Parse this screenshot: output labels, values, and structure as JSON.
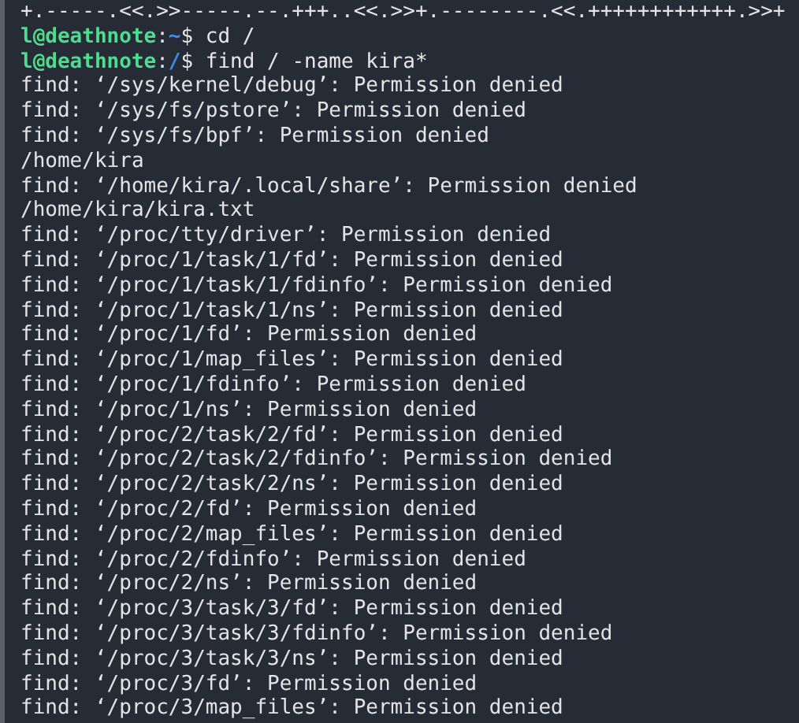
{
  "lines": [
    {
      "kind": "output",
      "text": "+.-----.<<.>>-----.--.+++..<<.>>+.--------.<<.++++++++++++.>>+"
    },
    {
      "kind": "prompt",
      "user_host": "l@deathnote",
      "colon": ":",
      "path": "~",
      "command": "$ cd /"
    },
    {
      "kind": "prompt",
      "user_host": "l@deathnote",
      "colon": ":",
      "path": "/",
      "command": "$ find / -name kira*"
    },
    {
      "kind": "output",
      "text": "find: ‘/sys/kernel/debug’: Permission denied"
    },
    {
      "kind": "output",
      "text": "find: ‘/sys/fs/pstore’: Permission denied"
    },
    {
      "kind": "output",
      "text": "find: ‘/sys/fs/bpf’: Permission denied"
    },
    {
      "kind": "output",
      "text": "/home/kira"
    },
    {
      "kind": "output",
      "text": "find: ‘/home/kira/.local/share’: Permission denied"
    },
    {
      "kind": "output",
      "text": "/home/kira/kira.txt"
    },
    {
      "kind": "output",
      "text": "find: ‘/proc/tty/driver’: Permission denied"
    },
    {
      "kind": "output",
      "text": "find: ‘/proc/1/task/1/fd’: Permission denied"
    },
    {
      "kind": "output",
      "text": "find: ‘/proc/1/task/1/fdinfo’: Permission denied"
    },
    {
      "kind": "output",
      "text": "find: ‘/proc/1/task/1/ns’: Permission denied"
    },
    {
      "kind": "output",
      "text": "find: ‘/proc/1/fd’: Permission denied"
    },
    {
      "kind": "output",
      "text": "find: ‘/proc/1/map_files’: Permission denied"
    },
    {
      "kind": "output",
      "text": "find: ‘/proc/1/fdinfo’: Permission denied"
    },
    {
      "kind": "output",
      "text": "find: ‘/proc/1/ns’: Permission denied"
    },
    {
      "kind": "output",
      "text": "find: ‘/proc/2/task/2/fd’: Permission denied"
    },
    {
      "kind": "output",
      "text": "find: ‘/proc/2/task/2/fdinfo’: Permission denied"
    },
    {
      "kind": "output",
      "text": "find: ‘/proc/2/task/2/ns’: Permission denied"
    },
    {
      "kind": "output",
      "text": "find: ‘/proc/2/fd’: Permission denied"
    },
    {
      "kind": "output",
      "text": "find: ‘/proc/2/map_files’: Permission denied"
    },
    {
      "kind": "output",
      "text": "find: ‘/proc/2/fdinfo’: Permission denied"
    },
    {
      "kind": "output",
      "text": "find: ‘/proc/2/ns’: Permission denied"
    },
    {
      "kind": "output",
      "text": "find: ‘/proc/3/task/3/fd’: Permission denied"
    },
    {
      "kind": "output",
      "text": "find: ‘/proc/3/task/3/fdinfo’: Permission denied"
    },
    {
      "kind": "output",
      "text": "find: ‘/proc/3/task/3/ns’: Permission denied"
    },
    {
      "kind": "output",
      "text": "find: ‘/proc/3/fd’: Permission denied"
    },
    {
      "kind": "output",
      "text": "find: ‘/proc/3/map_files’: Permission denied"
    }
  ]
}
